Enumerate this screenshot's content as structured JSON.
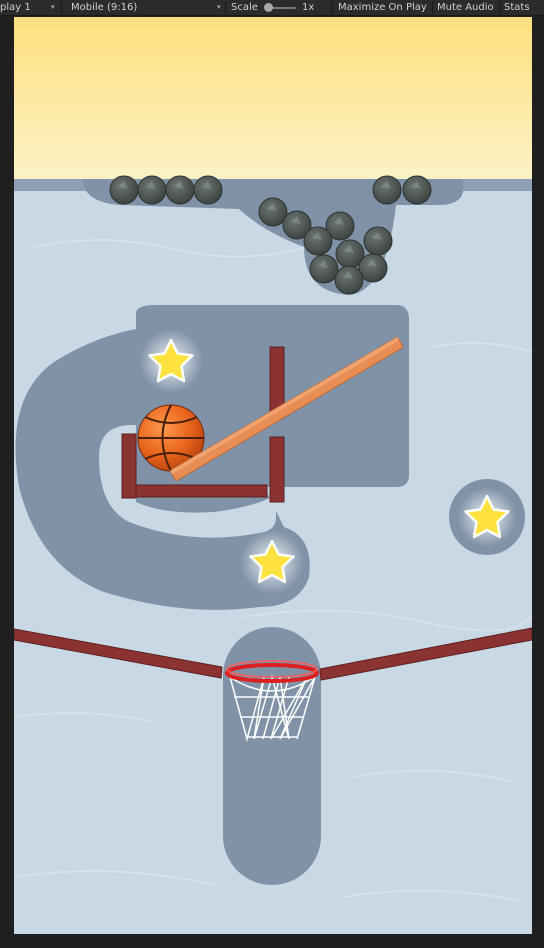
{
  "toolbar": {
    "display_label": "play 1",
    "aspect_label": "Mobile (9:16)",
    "scale_label": "Scale",
    "scale_value": "1x",
    "maximize_on_play": "Maximize On Play",
    "mute_audio": "Mute Audio",
    "stats": "Stats"
  },
  "colors": {
    "sky_top": "#ffe79a",
    "sky_bottom": "#fbf2c3",
    "water": "#c8d8e4",
    "carved_area": "#7f92a8",
    "wood_dark": "#8b3232",
    "plank": "#e88e55",
    "ball": "#e8641c",
    "rim": "#dd1f1f",
    "star": "#ffe23d",
    "rock": "#4b5250"
  },
  "game": {
    "stars_total": 3,
    "icons": [
      "star-icon",
      "basketball-icon",
      "hoop-icon",
      "boulder-icon"
    ]
  }
}
